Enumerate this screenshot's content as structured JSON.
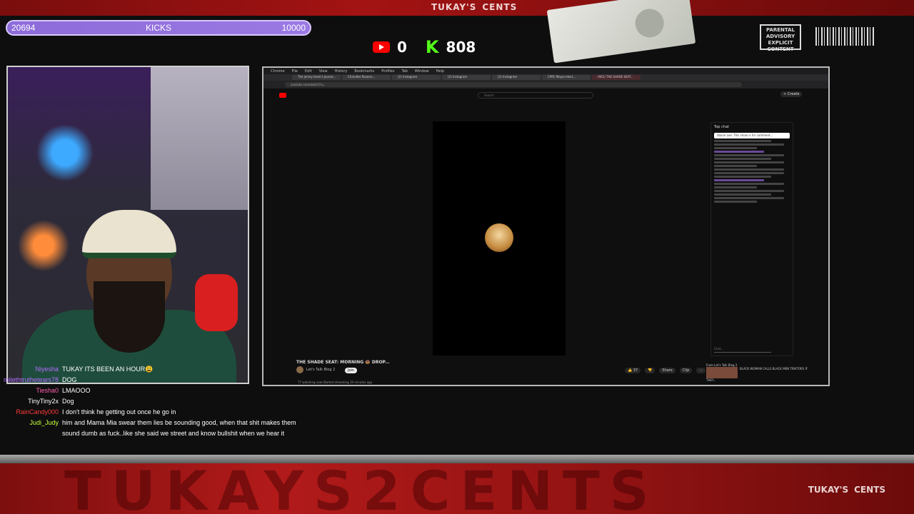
{
  "overlay": {
    "brand_left": "TUKAY'S",
    "brand_right": "CENTS",
    "goal": {
      "start": "20694",
      "label": "KICKS",
      "end": "10000"
    },
    "youtube_count": "0",
    "kick_letter": "K",
    "kick_count": "808",
    "advisory": "PARENTAL ADVISORY EXPLICIT CONTENT",
    "bottom_big_text": "TUKAYS2CENTS",
    "colors": {
      "accent_red": "#a31313",
      "goal_purple": "#9b7ae3",
      "kick_green": "#53fc18",
      "youtube_red": "#ff0000"
    }
  },
  "chat": [
    {
      "user": "Niyesha",
      "color": "#b46cff",
      "message": "TUKAY ITS BEEN AN HOUR😩"
    },
    {
      "user": "milethtruthetears78",
      "color": "#b46cff",
      "message": "DOG"
    },
    {
      "user": "Tiesha0",
      "color": "#ff5fb0",
      "message": "LMAOOO"
    },
    {
      "user": "TinyTiny2x",
      "color": "#ffffff",
      "message": "Dog"
    },
    {
      "user": "RainCandy000",
      "color": "#ff3a3a",
      "message": "I don't think he getting out once he go in"
    },
    {
      "user": "Judi_Judy",
      "color": "#c8ff3a",
      "message": "him and Mama Mia swear them lies be sounding good, when that shit makes them sound dumb as fuck..like she said we street and know bullshit when we hear it"
    }
  ],
  "browser": {
    "menu": [
      "Chrome",
      "File",
      "Edit",
      "View",
      "History",
      "Bookmarks",
      "Profiles",
      "Tab",
      "Window",
      "Help"
    ],
    "tabs": [
      "The jersey team's journe...",
      "Chandles Rosario...",
      "(2) Instagram",
      "(2) Instagram",
      "(2) Instagram",
      "CPRC Mayor-elect...",
      "(962) THE SHADE SEAT..."
    ],
    "url": "youtube.com/watch?v=",
    "search_placeholder": "Search",
    "create_label": "+ Create",
    "video": {
      "title": "THE SHADE SEAT: MORNING 🍩 DROP...",
      "channel": "Let's Talk Blog 2",
      "join": "Join",
      "stats": "77 watching now  Started streaming 19 minutes ago",
      "actions": [
        "👍 37",
        "👎",
        "Share",
        "Clip",
        "···"
      ]
    },
    "livechat": {
      "header": "Top chat",
      "pinned": "Stacie Lee: This show is for comment...",
      "input_placeholder": "Chat...",
      "related_tab": "From Let's Talk Blog 2",
      "related_title": "BLACK WOMAN CALLS BLACK MEN TRAITORS IF THEY..."
    }
  }
}
